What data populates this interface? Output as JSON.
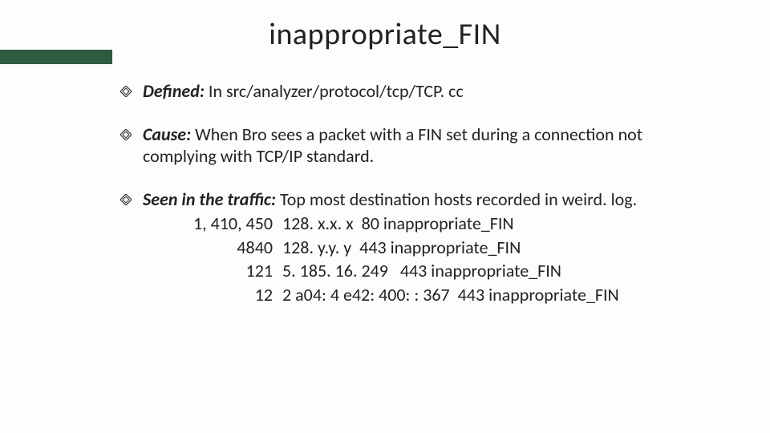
{
  "title": "inappropriate_FIN",
  "bullets": {
    "defined": {
      "label": "Defined:",
      "text": " In src/analyzer/protocol/tcp/TCP. cc"
    },
    "cause": {
      "label": "Cause:",
      "text": " When Bro sees a packet with a FIN set during a connection not complying with TCP/IP standard."
    },
    "seen": {
      "label": "Seen in the traffic:",
      "text": " Top most destination hosts recorded in weird. log."
    }
  },
  "records": [
    {
      "count": "1, 410, 450",
      "host": "128. x.x. x",
      "port": "80",
      "name": "inappropriate_FIN"
    },
    {
      "count": "4840",
      "host": "128. y.y. y",
      "port": "443",
      "name": "inappropriate_FIN"
    },
    {
      "count": "121",
      "host": "5. 185. 16. 249",
      "port": "443",
      "name": "inappropriate_FIN"
    },
    {
      "count": "12",
      "host": "2 a04: 4 e42: 400: : 367",
      "port": "443",
      "name": "inappropriate_FIN"
    }
  ],
  "accent_color": "#2e5b3f"
}
